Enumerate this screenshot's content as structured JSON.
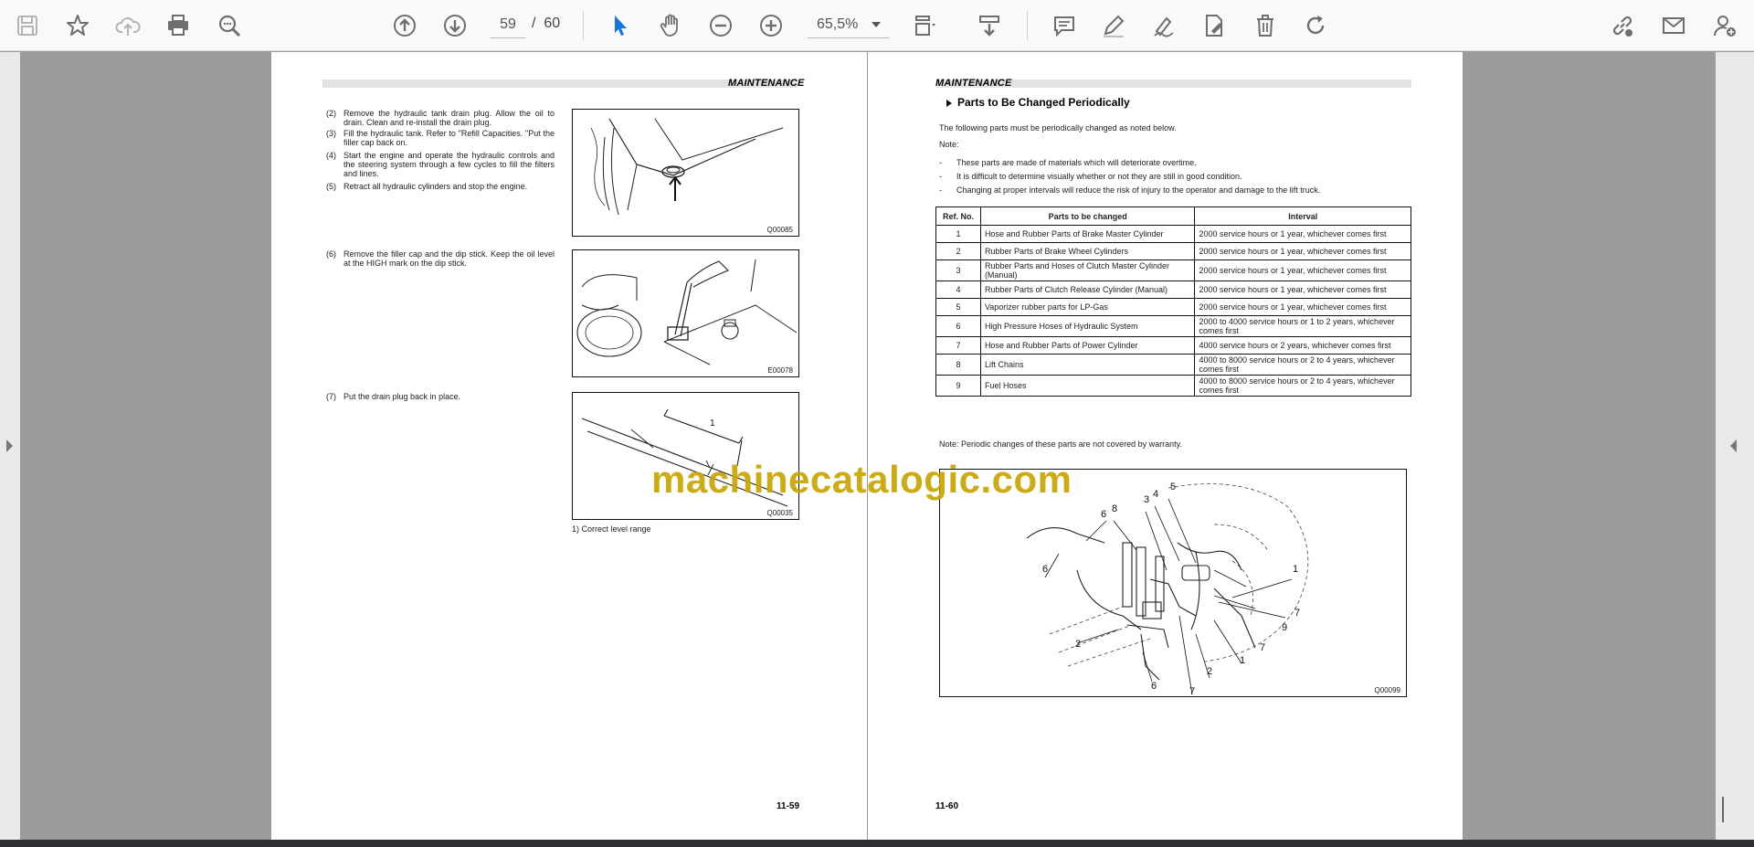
{
  "toolbar": {
    "current_page": "59",
    "page_separator": "/",
    "total_pages": "60",
    "zoom": "65,5%"
  },
  "left_page": {
    "header": "MAINTENANCE",
    "steps": [
      {
        "num": "(2)",
        "text": "Remove the hydraulic tank drain plug. Allow the oil to drain. Clean and re-install the drain plug."
      },
      {
        "num": "(3)",
        "text": "Fill the hydraulic tank. Refer to \"Refill Capacities. \"Put the filler cap back on."
      },
      {
        "num": "(4)",
        "text": "Start the engine and operate the hydraulic controls and the steering system through a few cycles to fill the filters and lines."
      },
      {
        "num": "(5)",
        "text": "Retract all hydraulic cylinders and stop the engine."
      },
      {
        "num": "(6)",
        "text": "Remove the filler cap and the dip stick. Keep the oil level at the HIGH mark on the dip stick."
      },
      {
        "num": "(7)",
        "text": "Put the drain plug back in place."
      }
    ],
    "figures": [
      {
        "code": "Q00085"
      },
      {
        "code": "E00078"
      },
      {
        "code": "Q00035",
        "callout": "1"
      }
    ],
    "caption": "1) Correct level range",
    "page_number": "11-59"
  },
  "right_page": {
    "header": "MAINTENANCE",
    "section_title": "Parts to Be Changed Periodically",
    "intro": "The following parts must be periodically changed as noted below.",
    "note_label": "Note:",
    "bullets": [
      "These parts are made of materials which will deteriorate overtime.",
      "It is difficult to determine visually whether or not they are still in good condition.",
      "Changing at proper intervals will reduce the risk of injury to the operator and damage to the lift truck."
    ],
    "table": {
      "headers": [
        "Ref. No.",
        "Parts to be changed",
        "Interval"
      ],
      "rows": [
        [
          "1",
          "Hose and Rubber Parts of Brake Master Cylinder",
          "2000 service hours or 1 year, whichever comes first"
        ],
        [
          "2",
          "Rubber Parts of Brake Wheel Cylinders",
          "2000 service hours or 1 year, whichever comes first"
        ],
        [
          "3",
          "Rubber Parts and Hoses of Clutch Master Cylinder (Manual)",
          "2000 service hours or 1 year, whichever comes first"
        ],
        [
          "4",
          "Rubber Parts of Clutch Release Cylinder (Manual)",
          "2000 service hours or 1 year, whichever comes first"
        ],
        [
          "5",
          "Vaporizer rubber parts for LP-Gas",
          "2000 service hours or 1 year, whichever comes first"
        ],
        [
          "6",
          "High Pressure Hoses of Hydraulic System",
          "2000 to 4000 service hours or 1 to 2 years, whichever comes first"
        ],
        [
          "7",
          "Hose and Rubber Parts of Power Cylinder",
          "4000 service hours or 2 years, whichever comes first"
        ],
        [
          "8",
          "Lift Chains",
          "4000 to 8000 service hours or 2 to 4 years, whichever comes first"
        ],
        [
          "9",
          "Fuel Hoses",
          "4000 to 8000 service hours or 2 to 4 years, whichever comes first"
        ]
      ]
    },
    "footnote": "Note: Periodic changes of these parts are not covered by warranty.",
    "diagram": {
      "code": "Q00099",
      "callouts": [
        "5",
        "4",
        "3",
        "8",
        "1",
        "6",
        "6",
        "7",
        "2",
        "9",
        "7",
        "1",
        "2",
        "6",
        "7"
      ]
    },
    "page_number": "11-60"
  },
  "watermark": "machinecatalogic.com",
  "icons": {
    "save": "save-icon",
    "bookmark": "star-icon",
    "upload": "cloud-upload-icon",
    "print": "print-icon",
    "zoom_search": "zoom-search-icon",
    "prev": "arrow-up-circle-icon",
    "next": "arrow-down-circle-icon",
    "select": "cursor-icon",
    "pan": "hand-icon",
    "zoom_out": "minus-circle-icon",
    "zoom_in": "plus-circle-icon",
    "fit": "fit-page-icon",
    "scroll_mode": "scroll-mode-icon",
    "comment": "comment-icon",
    "highlight": "pen-icon",
    "sign": "sign-icon",
    "fill_sign": "fill-sign-icon",
    "delete": "trash-icon",
    "rotate": "rotate-icon",
    "share_link": "link-icon",
    "email": "mail-icon",
    "add_user": "add-user-icon"
  },
  "colors": {
    "toolbar_bg": "#f9f9f9",
    "icon_gray": "#6e6e6e",
    "active_blue": "#1473e6",
    "viewer_bg": "#9b9b9b",
    "watermark": "#c9a400"
  }
}
